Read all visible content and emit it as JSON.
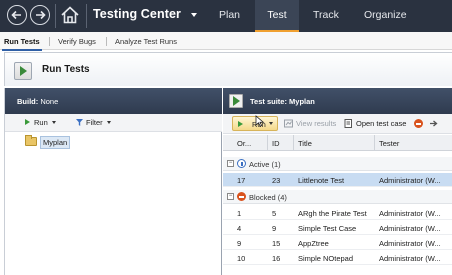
{
  "topbar": {
    "back_icon": "back-arrow-icon",
    "forward_icon": "forward-arrow-icon",
    "home_icon": "home-icon",
    "title": "Testing Center",
    "tabs": [
      {
        "label": "Plan"
      },
      {
        "label": "Test"
      },
      {
        "label": "Track"
      },
      {
        "label": "Organize"
      }
    ],
    "active_tab": "Test"
  },
  "subnav": {
    "items": [
      {
        "label": "Run Tests"
      },
      {
        "label": "Verify Bugs"
      },
      {
        "label": "Analyze Test Runs"
      }
    ]
  },
  "page": {
    "title": "Run Tests"
  },
  "left": {
    "build_label": "Build:",
    "build_value": "None",
    "run_label": "Run",
    "filter_label": "Filter",
    "tree": [
      {
        "label": "Myplan"
      }
    ]
  },
  "right": {
    "suite_label": "Test suite:",
    "suite_value": "Myplan",
    "toolbar": {
      "run_label": "Run",
      "view_results_label": "View results",
      "open_test_case_label": "Open test case"
    },
    "columns": [
      "Or...",
      "ID",
      "Title",
      "Tester"
    ],
    "groups": [
      {
        "label": "Active (1)",
        "status": "active",
        "rows": [
          {
            "order": "17",
            "id": "23",
            "title": "Littlenote Test",
            "tester": "Administrator (W..."
          }
        ]
      },
      {
        "label": "Blocked (4)",
        "status": "blocked",
        "rows": [
          {
            "order": "1",
            "id": "5",
            "title": "ARgh the Pirate Test",
            "tester": "Administrator (W..."
          },
          {
            "order": "4",
            "id": "9",
            "title": "Simple Test Case",
            "tester": "Administrator (W..."
          },
          {
            "order": "9",
            "id": "15",
            "title": "AppZtree",
            "tester": "Administrator (W..."
          },
          {
            "order": "10",
            "id": "16",
            "title": "Simple NOtepad",
            "tester": "Administrator (W..."
          }
        ]
      }
    ]
  },
  "colors": {
    "topbar_bg": "#2a3240",
    "panel_header_bg": "#3a475c",
    "selected_row": "#c8dcf2",
    "active_tab_underline": "#f0a030"
  }
}
